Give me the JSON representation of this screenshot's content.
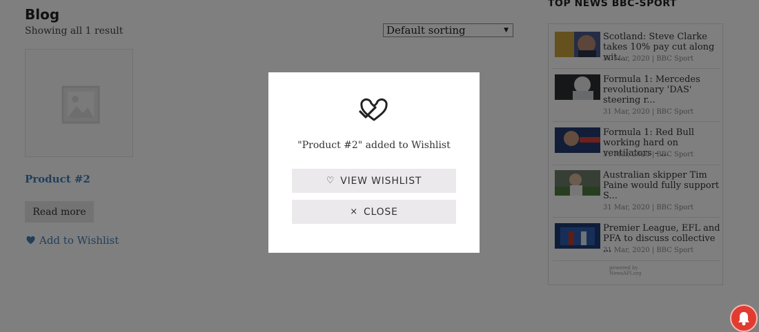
{
  "page": {
    "title": "Blog",
    "result_count": "Showing all 1 result",
    "sorting": {
      "selected": "Default sorting"
    }
  },
  "product": {
    "title": "Product #2",
    "read_more_label": "Read more",
    "wishlist_label": "Add to Wishlist"
  },
  "sidebar": {
    "heading": "TOP NEWS BBC-SPORT",
    "items": [
      {
        "title": "Scotland: Steve Clarke takes 10% pay cut along wit...",
        "meta": "31 Mar, 2020 | BBC Sport"
      },
      {
        "title": "Formula 1: Mercedes revolutionary 'DAS' steering r...",
        "meta": "31 Mar, 2020 | BBC Sport"
      },
      {
        "title": "Formula 1: Red Bull working hard on ventilators - ...",
        "meta": "31 Mar, 2020 | BBC Sport"
      },
      {
        "title": "Australian skipper Tim Paine would fully support S...",
        "meta": "31 Mar, 2020 | BBC Sport"
      },
      {
        "title": "Premier League, EFL and PFA to discuss collective ...",
        "meta": "31 Mar, 2020 | BBC Sport"
      }
    ],
    "powered_line1": "powered by",
    "powered_line2": "NewsAPI.org"
  },
  "modal": {
    "message": "\"Product #2\" added to Wishlist",
    "view_label": "VIEW WISHLIST",
    "close_label": "CLOSE"
  },
  "colors": {
    "link": "#3e7eb8",
    "overlay": "rgba(0,0,0,0.5)",
    "button_bg": "#ebe9eb",
    "notification": "#e03c31"
  },
  "icons": {
    "modal": "heart-check-icon",
    "wishlist": "heart-icon",
    "view": "heart-outline-icon",
    "close": "close-icon",
    "notification": "bell-icon"
  }
}
